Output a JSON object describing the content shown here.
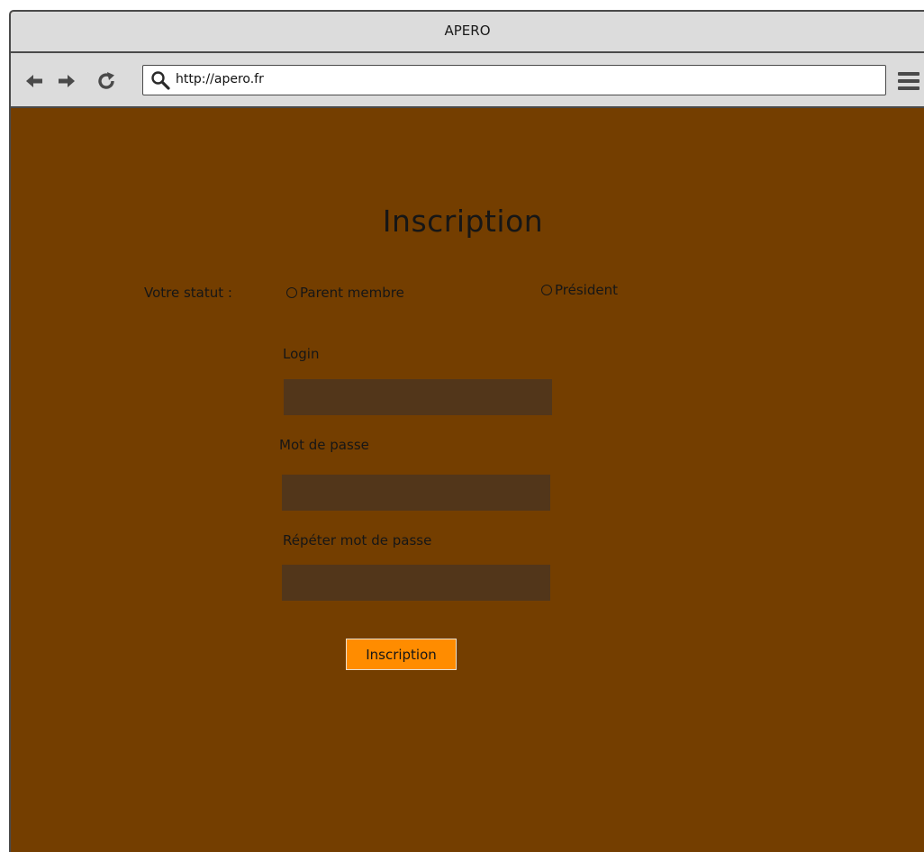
{
  "window": {
    "title": "APERO"
  },
  "toolbar": {
    "back_icon": "arrow-left-icon",
    "forward_icon": "arrow-right-icon",
    "reload_icon": "reload-icon",
    "menu_icon": "hamburger-menu-icon",
    "url": "http://apero.fr"
  },
  "form": {
    "title": "Inscription",
    "status_label": "Votre statut :",
    "status_options": [
      {
        "label": "Parent membre",
        "selected": false
      },
      {
        "label": "Président",
        "selected": false
      }
    ],
    "login_label": "Login",
    "login_value": "",
    "password_label": "Mot de passe",
    "password_value": "",
    "repeat_password_label": "Répéter mot de passe",
    "repeat_password_value": "",
    "submit_label": "Inscription"
  },
  "colors": {
    "page_background": "#743e00",
    "field_background": "#52361a",
    "button_background": "#ff8c00",
    "chrome_background": "#dcdcdc"
  }
}
